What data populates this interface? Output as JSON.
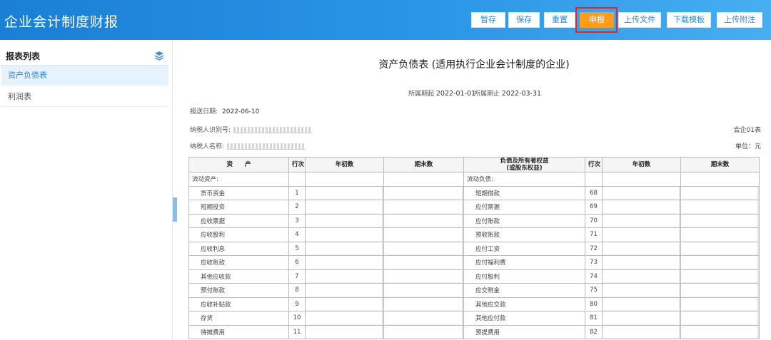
{
  "app": {
    "title": "企业会计制度财报"
  },
  "toolbar": {
    "buttons": [
      {
        "label": "暂存"
      },
      {
        "label": "保存"
      },
      {
        "label": "重置"
      },
      {
        "label": "申报"
      },
      {
        "label": "上传文件"
      },
      {
        "label": "下载模板"
      },
      {
        "label": "上传附注"
      }
    ],
    "highlight_color": "#e0262b",
    "primary_color": "#ff9c1a"
  },
  "sidebar": {
    "title": "报表列表",
    "icon": "layers-icon",
    "items": [
      {
        "label": "资产负债表",
        "active": true
      },
      {
        "label": "利润表",
        "active": false
      }
    ]
  },
  "report": {
    "title": "资产负债表 (适用执行企业会计制度的企业)",
    "period_start_label": "所属期起",
    "period_start": "2022-01-01",
    "period_end_label": "所属期止",
    "period_end": "2022-03-31",
    "submit_date_label": "报送日期:",
    "submit_date": "2022-06-10",
    "taxpayer_id_label": "纳税人识别号:",
    "taxpayer_name_label": "纳税人名称:",
    "form_code": "会企01表",
    "unit": "单位：元",
    "columns": {
      "asset": "资　　产",
      "row_no": "行次",
      "begin": "年初数",
      "end": "期末数",
      "liab": "负债及所有者权益\n(或股东权益)"
    },
    "rows": [
      {
        "a": "流动资产:",
        "a_no": "",
        "l": "流动负债:",
        "l_no": "",
        "section": true
      },
      {
        "a": "货币资金",
        "a_no": "1",
        "l": "短期借款",
        "l_no": "68"
      },
      {
        "a": "短期投资",
        "a_no": "2",
        "l": "应付票据",
        "l_no": "69"
      },
      {
        "a": "应收票据",
        "a_no": "3",
        "l": "应付账款",
        "l_no": "70"
      },
      {
        "a": "应收股利",
        "a_no": "4",
        "l": "预收账款",
        "l_no": "71"
      },
      {
        "a": "应收利息",
        "a_no": "5",
        "l": "应付工资",
        "l_no": "72"
      },
      {
        "a": "应收账款",
        "a_no": "6",
        "l": "应付福利费",
        "l_no": "73"
      },
      {
        "a": "其他应收款",
        "a_no": "7",
        "l": "应付股利",
        "l_no": "74"
      },
      {
        "a": "预付账款",
        "a_no": "8",
        "l": "应交税金",
        "l_no": "75"
      },
      {
        "a": "应收补贴款",
        "a_no": "9",
        "l": "其他应交款",
        "l_no": "80"
      },
      {
        "a": "存货",
        "a_no": "10",
        "l": "其他应付款",
        "l_no": "81"
      },
      {
        "a": "待摊费用",
        "a_no": "11",
        "l": "预提费用",
        "l_no": "82"
      }
    ]
  }
}
